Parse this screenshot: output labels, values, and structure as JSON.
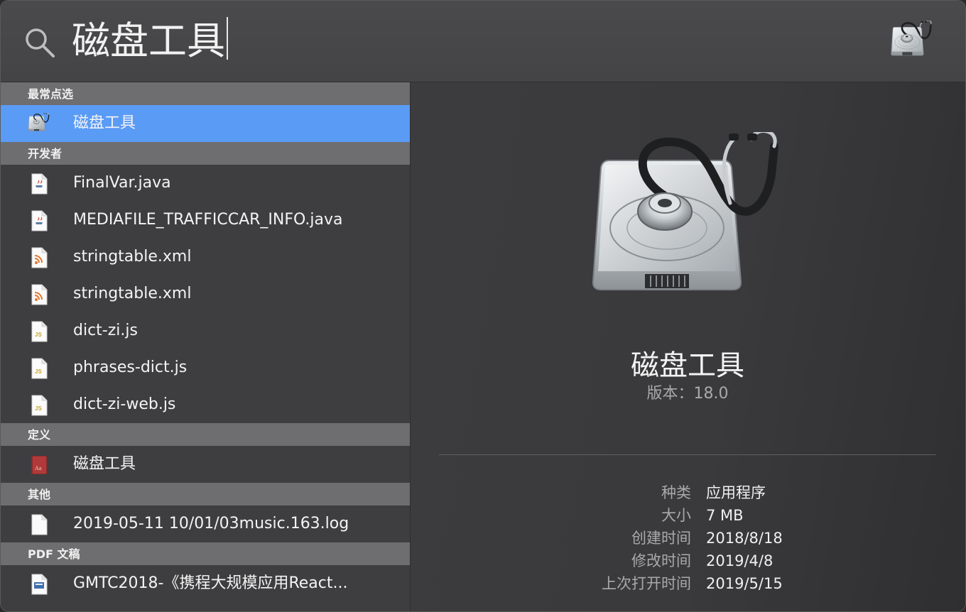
{
  "search": {
    "query": "磁盘工具"
  },
  "results": {
    "sections": [
      {
        "title": "最常点选",
        "items": [
          {
            "label": "磁盘工具",
            "icon": "disk-utility-icon",
            "selected": true
          }
        ]
      },
      {
        "title": "开发者",
        "items": [
          {
            "label": "FinalVar.java",
            "icon": "java-file-icon"
          },
          {
            "label": "MEDIAFILE_TRAFFICCAR_INFO.java",
            "icon": "java-file-icon"
          },
          {
            "label": "stringtable.xml",
            "icon": "xml-file-icon"
          },
          {
            "label": "stringtable.xml",
            "icon": "xml-file-icon"
          },
          {
            "label": "dict-zi.js",
            "icon": "js-file-icon"
          },
          {
            "label": "phrases-dict.js",
            "icon": "js-file-icon"
          },
          {
            "label": "dict-zi-web.js",
            "icon": "js-file-icon"
          }
        ]
      },
      {
        "title": "定义",
        "items": [
          {
            "label": "磁盘工具",
            "icon": "dictionary-icon"
          }
        ]
      },
      {
        "title": "其他",
        "items": [
          {
            "label": "2019-05-11 10/01/03music.163.log",
            "icon": "document-icon"
          }
        ]
      },
      {
        "title": "PDF 文稿",
        "items": [
          {
            "label": "GMTC2018-《携程大规模应用React...",
            "icon": "pdf-file-icon"
          }
        ]
      }
    ]
  },
  "preview": {
    "app_name": "磁盘工具",
    "version": "版本：18.0",
    "metadata": [
      {
        "key": "种类",
        "value": "应用程序"
      },
      {
        "key": "大小",
        "value": "7 MB"
      },
      {
        "key": "创建时间",
        "value": "2018/8/18"
      },
      {
        "key": "修改时间",
        "value": "2019/4/8"
      },
      {
        "key": "上次打开时间",
        "value": "2019/5/15"
      }
    ]
  },
  "colors": {
    "selection": "#5a9bf6",
    "section_header": "#6e6e70",
    "background": "#3a3a3c"
  }
}
